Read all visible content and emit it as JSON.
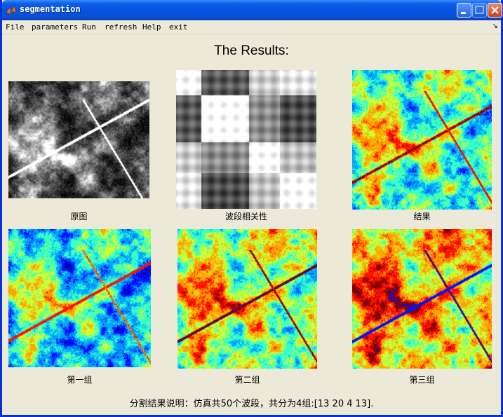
{
  "window": {
    "title": "segmentation",
    "controls": {
      "minimize": "minimize",
      "maximize": "maximize",
      "close": "close"
    }
  },
  "menubar": {
    "items": [
      "File",
      "parameters",
      "Run",
      "refresh",
      "Help",
      "exit"
    ],
    "dock_glyph": "↘"
  },
  "figure": {
    "heading": "The Results:",
    "panels": [
      {
        "caption": "原图",
        "colormap": "gray"
      },
      {
        "caption": "波段相关性",
        "colormap": "gray"
      },
      {
        "caption": "结果",
        "colormap": "jet"
      },
      {
        "caption": "第一组",
        "colormap": "jet"
      },
      {
        "caption": "第二组",
        "colormap": "jet"
      },
      {
        "caption": "第三组",
        "colormap": "jet"
      }
    ],
    "summary": "分割结果说明：仿真共50个波段，共分为4组:[13  20   4  13]."
  },
  "colors": {
    "title_bar": "#0653e0",
    "window_bg": "#ece9d8",
    "close_button": "#c9411d"
  }
}
